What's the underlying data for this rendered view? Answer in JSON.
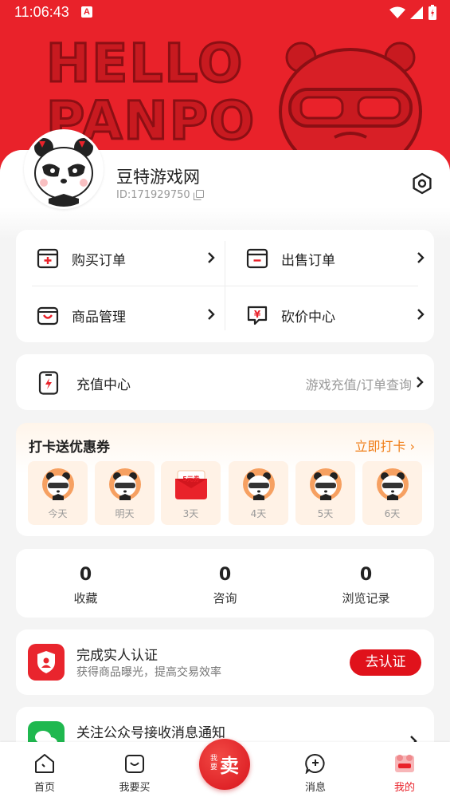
{
  "status_bar": {
    "time": "11:06:43",
    "notif_letter": "A"
  },
  "header": {
    "banner_text_line1": "HELLO",
    "banner_text_line2": "PANPO"
  },
  "profile": {
    "username": "豆特游戏网",
    "user_id": "ID:171929750"
  },
  "orders": {
    "buy_orders": "购买订单",
    "sell_orders": "出售订单",
    "product_mgmt": "商品管理",
    "bargain_center": "砍价中心"
  },
  "recharge": {
    "label": "充值中心",
    "sub": "游戏充值/订单查询"
  },
  "checkin": {
    "title": "打卡送优惠券",
    "link": "立即打卡",
    "coupon_text": "5元券",
    "days": [
      "今天",
      "明天",
      "3天",
      "4天",
      "5天",
      "6天"
    ]
  },
  "stats": [
    {
      "value": "0",
      "label": "收藏"
    },
    {
      "value": "0",
      "label": "咨询"
    },
    {
      "value": "0",
      "label": "浏览记录"
    }
  ],
  "verify": {
    "title": "完成实人认证",
    "sub": "获得商品曝光，提高交易效率",
    "button": "去认证"
  },
  "wechat": {
    "title": "关注公众号接收消息通知"
  },
  "tabbar": {
    "home": "首页",
    "buy": "我要买",
    "sell_small": "我要",
    "sell_big": "卖",
    "messages": "消息",
    "mine": "我的"
  },
  "colors": {
    "brand_red": "#e9222a",
    "accent_orange": "#f07d16",
    "wechat_green": "#1fb84f"
  }
}
